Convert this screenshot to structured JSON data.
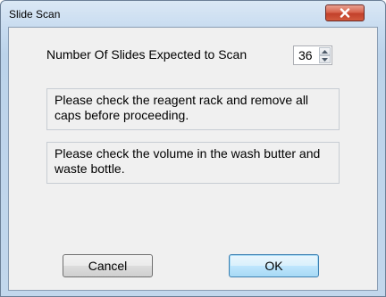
{
  "window": {
    "title": "Slide Scan",
    "close_icon": "close-x-icon"
  },
  "slides": {
    "label": "Number Of Slides Expected to Scan",
    "value": "36",
    "spin_icons": [
      "spin-up-icon",
      "spin-down-icon"
    ]
  },
  "messages": {
    "reagent": "Please check the reagent rack and remove all caps before proceeding.",
    "volume": "Please check the volume in the wash butter and waste bottle."
  },
  "buttons": {
    "cancel": "Cancel",
    "ok": "OK"
  },
  "colors": {
    "close_button": "#c2402a",
    "ok_button_border": "#3c7fb1"
  }
}
